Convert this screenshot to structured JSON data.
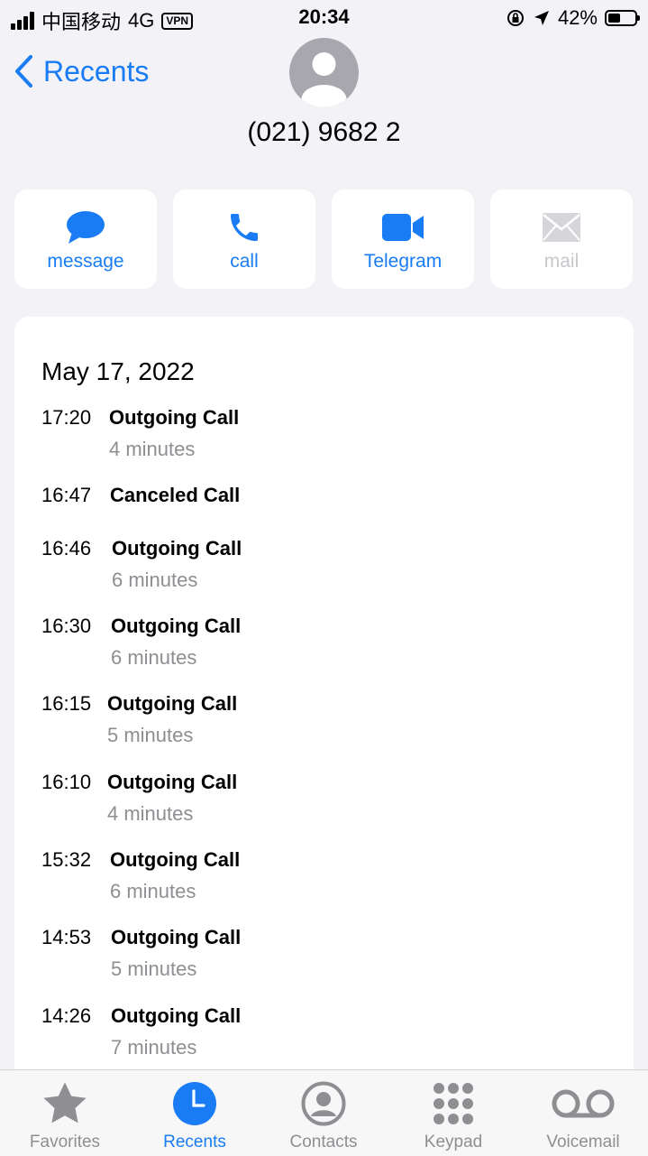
{
  "status_bar": {
    "carrier": "中国移动",
    "network": "4G",
    "vpn": "VPN",
    "time": "20:34",
    "battery": "42%"
  },
  "header": {
    "back_label": "Recents",
    "number": "(021) 9682 2"
  },
  "actions": [
    {
      "label": "message",
      "icon": "message-bubble-icon",
      "enabled": true
    },
    {
      "label": "call",
      "icon": "phone-icon",
      "enabled": true
    },
    {
      "label": "Telegram",
      "icon": "video-camera-icon",
      "enabled": true
    },
    {
      "label": "mail",
      "icon": "envelope-icon",
      "enabled": false
    }
  ],
  "history": {
    "date": "May 17, 2022",
    "entries": [
      {
        "time": "17:20",
        "type": "Outgoing Call",
        "duration": "4 minutes"
      },
      {
        "time": "16:47",
        "type": "Canceled Call",
        "duration": ""
      },
      {
        "time": "16:46",
        "type": "Outgoing Call",
        "duration": "6 minutes"
      },
      {
        "time": "16:30",
        "type": "Outgoing Call",
        "duration": "6 minutes"
      },
      {
        "time": "16:15",
        "type": "Outgoing Call",
        "duration": "5 minutes"
      },
      {
        "time": "16:10",
        "type": "Outgoing Call",
        "duration": "4 minutes"
      },
      {
        "time": "15:32",
        "type": "Outgoing Call",
        "duration": "6 minutes"
      },
      {
        "time": "14:53",
        "type": "Outgoing Call",
        "duration": "5 minutes"
      },
      {
        "time": "14:26",
        "type": "Outgoing Call",
        "duration": "7 minutes"
      }
    ]
  },
  "tabs": [
    {
      "label": "Favorites",
      "icon": "star-icon",
      "active": false
    },
    {
      "label": "Recents",
      "icon": "clock-icon",
      "active": true
    },
    {
      "label": "Contacts",
      "icon": "person-circle-icon",
      "active": false
    },
    {
      "label": "Keypad",
      "icon": "keypad-icon",
      "active": false
    },
    {
      "label": "Voicemail",
      "icon": "voicemail-icon",
      "active": false
    }
  ],
  "colors": {
    "accent": "#1a7cf4",
    "background": "#f2f2f7",
    "secondary_text": "#8e8e93",
    "disabled": "#c7c7cc"
  }
}
